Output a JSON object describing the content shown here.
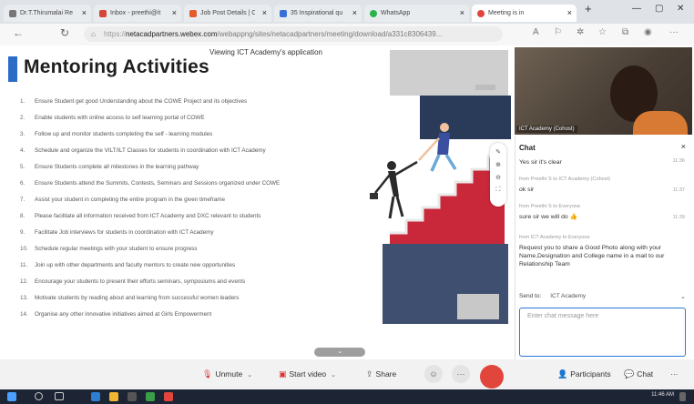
{
  "browser": {
    "tabs": [
      {
        "title": "Dr.T.Thirumalai Re",
        "icon_color": "#777777"
      },
      {
        "title": "Inbox - preethi@it",
        "icon_color": "#d44638"
      },
      {
        "title": "Job Post Details | C",
        "icon_color": "#e25b2a"
      },
      {
        "title": "35 Inspirational qu",
        "icon_color": "#3b6fd8"
      },
      {
        "title": "WhatsApp",
        "icon_color": "#2bb34a"
      },
      {
        "title": "Meeting is in",
        "icon_color": "#e2453c"
      }
    ],
    "new_tab": "+",
    "url_scheme": "https://",
    "url_host": "netacadpartners.webex.com",
    "url_path": "/webappng/sites/netacadpartners/meeting/download/a331c8306439..."
  },
  "share": {
    "viewing_label": "Viewing ICT Academy's application"
  },
  "slide": {
    "title": "Mentoring Activities",
    "items": [
      {
        "num": "1.",
        "text": "Ensure Student get good Understanding about the COWE Project and its objectives"
      },
      {
        "num": "2.",
        "text": "Enable students with online access to self learning portal of COWE"
      },
      {
        "num": "3.",
        "text": "Follow up and monitor students completing the self - learning modules"
      },
      {
        "num": "4.",
        "text": "Schedule and organize the VILT/ILT Classes for students in coordination with ICT Academy"
      },
      {
        "num": "5.",
        "text": "Ensure Students complete all milestones in the learning pathway"
      },
      {
        "num": "6.",
        "text": "Ensure Students attend the Summits, Contests, Seminars and Sessions organized under COWE"
      },
      {
        "num": "7.",
        "text": "Assist your student in completing the entire program in the given timeframe"
      },
      {
        "num": "8.",
        "text": "Please facilitate all information received from ICT Academy and DXC relevant to students"
      },
      {
        "num": "9.",
        "text": "Facilitate Job interviews for students in coordination with ICT Academy"
      },
      {
        "num": "10.",
        "text": "Schedule regular meetings with your student to ensure progress"
      },
      {
        "num": "11.",
        "text": "Join up with other departments and faculty mentors to create new opportunities"
      },
      {
        "num": "12.",
        "text": "Encourage your students to present their efforts seminars, symposiums and events"
      },
      {
        "num": "13.",
        "text": "Motivate students by reading about and learning from successful women leaders"
      },
      {
        "num": "14.",
        "text": "Organise any other innovative initiatives aimed at Girls Empowerment"
      }
    ]
  },
  "video": {
    "participant_label": "ICT Academy (Cohost)"
  },
  "chat": {
    "title": "Chat",
    "close": "×",
    "messages": [
      {
        "from": "",
        "text": "Yes sir it's clear",
        "time": "11:36"
      },
      {
        "from": "from Preethi S to ICT Academy (Cohost)",
        "text": "ok sir",
        "time": "11:37"
      },
      {
        "from": "from Preethi S to Everyone",
        "text": "sure sir we will do",
        "time": "11:39"
      },
      {
        "from": "from ICT Academy to Everyone",
        "text": "Request you to share a Good Photo along with your Name,Designation and College name in a mail to our Relationship Team",
        "time": ""
      }
    ],
    "send_to_label": "Send to:",
    "send_to_value": "ICT Academy",
    "input_placeholder": "Enter chat message here"
  },
  "controls": {
    "unmute": "Unmute",
    "start_video": "Start video",
    "share": "Share",
    "participants": "Participants",
    "chat": "Chat",
    "more": "···"
  },
  "taskbar": {
    "clock": "11:46 AM"
  },
  "colors": {
    "accent": "#2b6dc6",
    "end_call": "#e2453c",
    "stairs": "#c8283a"
  }
}
